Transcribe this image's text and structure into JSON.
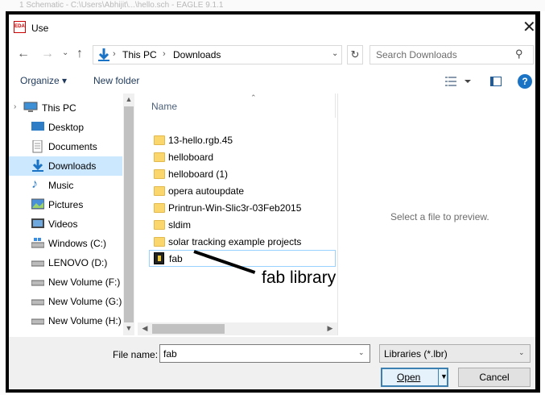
{
  "window": {
    "title": "Use",
    "app_icon_text": "EDA",
    "background_title": "1 Schematic - C:\\Users\\Abhijit\\...\\hello.sch - EAGLE 9.1.1"
  },
  "address": {
    "crumbs": [
      "This PC",
      "Downloads"
    ]
  },
  "search": {
    "placeholder": "Search Downloads"
  },
  "toolbar": {
    "organize_label": "Organize ▾",
    "new_folder_label": "New folder",
    "help_label": "?"
  },
  "nav": {
    "items": [
      {
        "label": "This PC",
        "icon": "computer-icon"
      },
      {
        "label": "Desktop",
        "icon": "desktop-icon"
      },
      {
        "label": "Documents",
        "icon": "documents-icon"
      },
      {
        "label": "Downloads",
        "icon": "downloads-icon"
      },
      {
        "label": "Music",
        "icon": "music-icon"
      },
      {
        "label": "Pictures",
        "icon": "pictures-icon"
      },
      {
        "label": "Videos",
        "icon": "videos-icon"
      },
      {
        "label": "Windows (C:)",
        "icon": "drive-icon"
      },
      {
        "label": "LENOVO (D:)",
        "icon": "drive-icon"
      },
      {
        "label": "New Volume (F:)",
        "icon": "drive-icon"
      },
      {
        "label": "New Volume (G:)",
        "icon": "drive-icon"
      },
      {
        "label": "New Volume (H:)",
        "icon": "drive-icon"
      }
    ]
  },
  "files": {
    "column_name": "Name",
    "items": [
      {
        "label": "13-hello.rgb.45",
        "type": "folder"
      },
      {
        "label": "helloboard",
        "type": "folder"
      },
      {
        "label": "helloboard (1)",
        "type": "folder"
      },
      {
        "label": "opera autoupdate",
        "type": "folder"
      },
      {
        "label": "Printrun-Win-Slic3r-03Feb2015",
        "type": "folder"
      },
      {
        "label": "sldim",
        "type": "folder"
      },
      {
        "label": "solar tracking example projects",
        "type": "folder"
      },
      {
        "label": "fab",
        "type": "library"
      }
    ]
  },
  "preview": {
    "message": "Select a file to preview."
  },
  "footer": {
    "file_name_label": "File name:",
    "file_name_value": "fab",
    "file_type_value": "Libraries (*.lbr)",
    "open_label": "Open",
    "cancel_label": "Cancel"
  },
  "annotation": {
    "text": "fab library"
  },
  "colors": {
    "selection": "#cce8ff",
    "accent": "#1a73c5",
    "folder": "#fbd66d"
  }
}
